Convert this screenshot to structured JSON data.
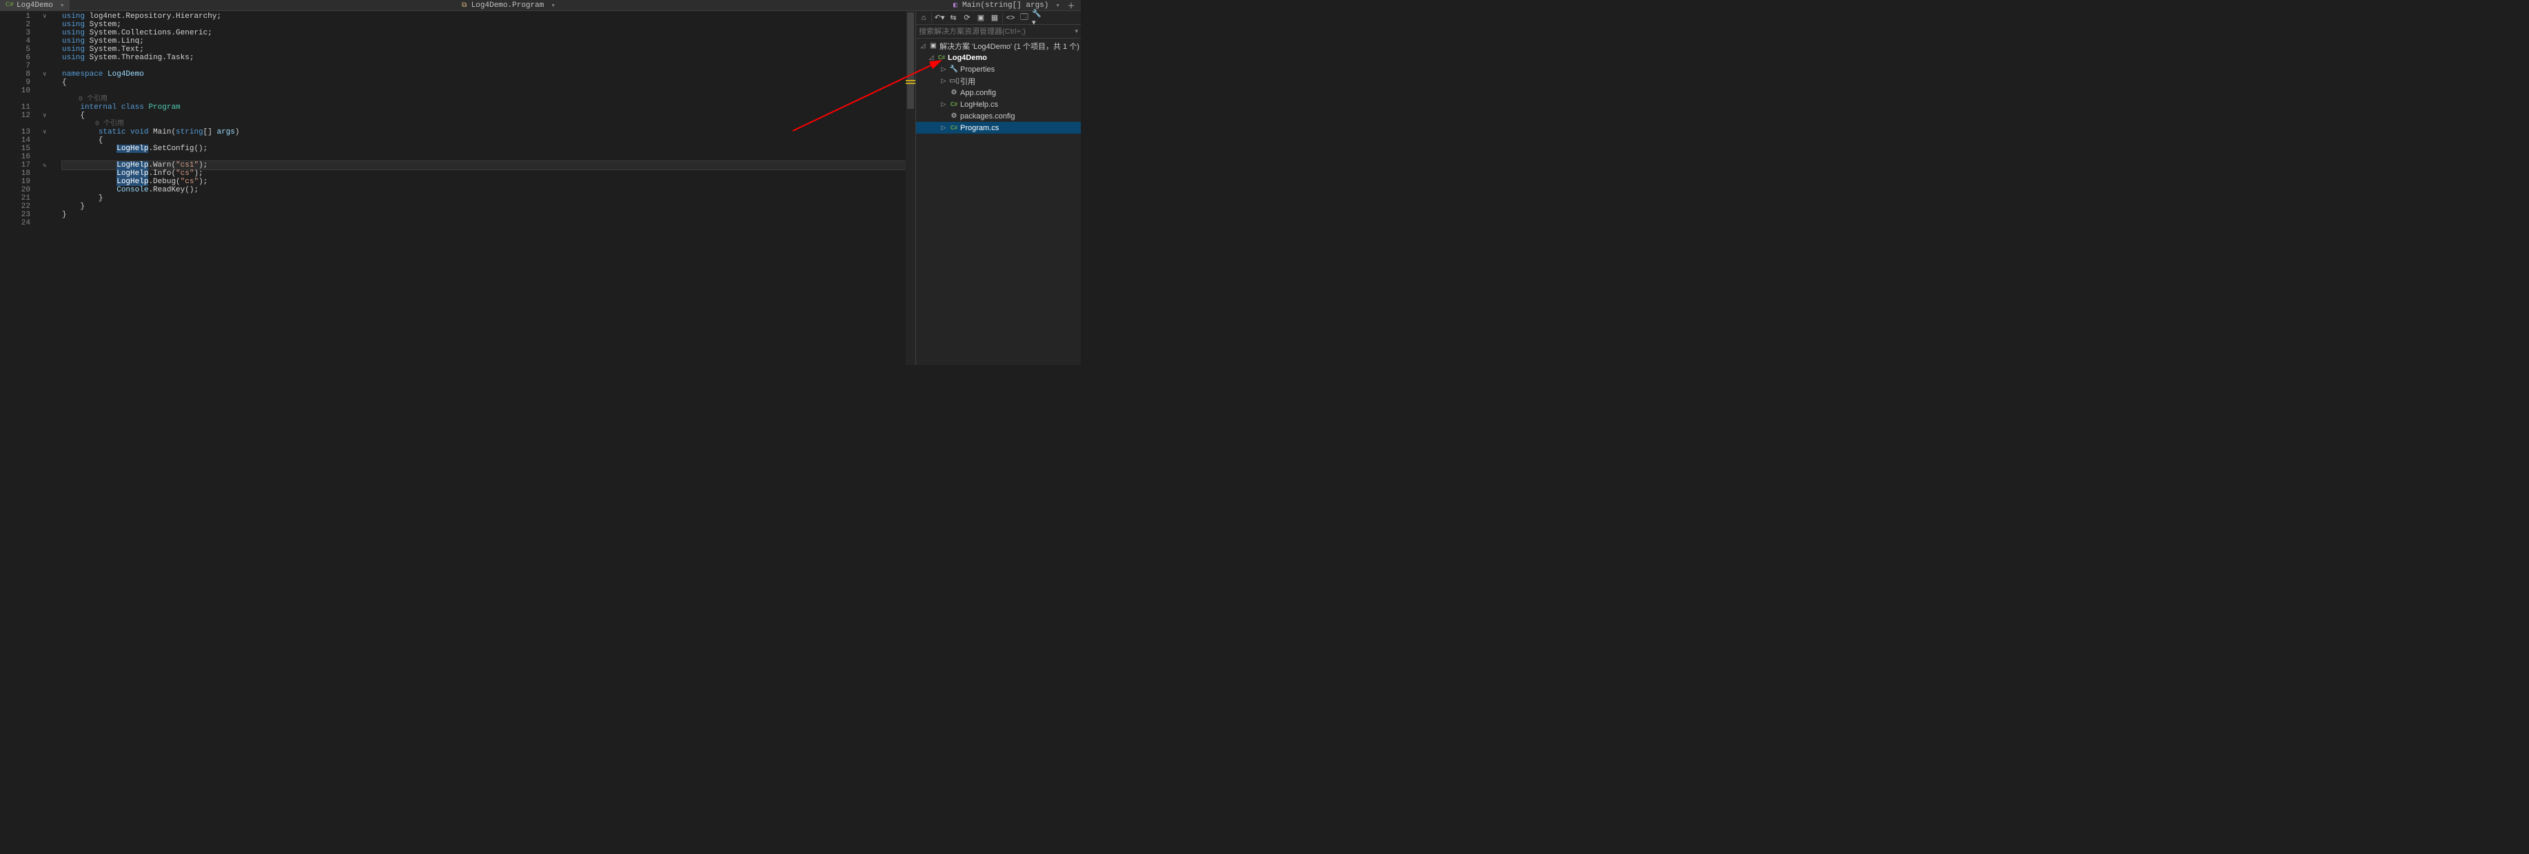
{
  "breadcrumb": {
    "path1_icon": "csharp-file-icon",
    "path1": "Log4Demo",
    "path2_icon": "namespace-icon",
    "path2": "Log4Demo.Program",
    "path3_icon": "method-icon",
    "path3": "Main(string[] args)"
  },
  "code": {
    "lines": [
      {
        "n": 1,
        "fold": "∨",
        "html": "<span class='kw'>using</span> log4net.Repository.Hierarchy;"
      },
      {
        "n": 2,
        "html": "<span class='kw'>using</span> System;"
      },
      {
        "n": 3,
        "html": "<span class='kw'>using</span> System.Collections.Generic;"
      },
      {
        "n": 4,
        "html": "<span class='kw'>using</span> System.Linq;"
      },
      {
        "n": 5,
        "html": "<span class='kw'>using</span> System.Text;"
      },
      {
        "n": 6,
        "html": "<span class='kw'>using</span> System.Threading.Tasks;"
      },
      {
        "n": 7,
        "html": ""
      },
      {
        "n": 8,
        "fold": "∨",
        "html": "<span class='kw'>namespace</span> <span class='typ'>Log4Demo</span>"
      },
      {
        "n": 9,
        "html": "{"
      },
      {
        "n": 10,
        "html": ""
      },
      {
        "n": "",
        "hint": "    0 个引用",
        "isHint": true
      },
      {
        "n": 11,
        "html": "    <span class='kw'>internal</span> <span class='kw'>class</span> <span class='cls'>Program</span>"
      },
      {
        "n": 12,
        "fold": "∨",
        "html": "    {"
      },
      {
        "n": "",
        "hint": "        0 个引用",
        "isHint": true
      },
      {
        "n": 13,
        "fold": "∨",
        "html": "        <span class='kw'>static</span> <span class='kw'>void</span> Main(<span class='kw'>string</span>[] <span class='param'>args</span>)"
      },
      {
        "n": 14,
        "html": "        {"
      },
      {
        "n": 15,
        "html": "            <span class='sel'>LogHelp</span>.SetConfig();"
      },
      {
        "n": 16,
        "html": ""
      },
      {
        "n": 17,
        "current": true,
        "pencil": true,
        "html": "            <span class='sel'>LogHelp</span>.Warn(<span class='str'>\"cs1\"</span>);"
      },
      {
        "n": 18,
        "html": "            <span class='sel'>LogHelp</span>.Info(<span class='str'>\"cs\"</span>);"
      },
      {
        "n": 19,
        "html": "            <span class='sel'>LogHelp</span>.Debug(<span class='str'>\"cs\"</span>);"
      },
      {
        "n": 20,
        "html": "            <span class='typ'>Console</span>.ReadKey();"
      },
      {
        "n": 21,
        "html": "        }"
      },
      {
        "n": 22,
        "html": "    }"
      },
      {
        "n": 23,
        "html": "}"
      },
      {
        "n": 24,
        "html": ""
      }
    ]
  },
  "search_placeholder": "搜索解决方案资源管理器(Ctrl+;)",
  "solution": {
    "root": "解决方案 'Log4Demo' (1 个项目，共 1 个)",
    "project": "Log4Demo",
    "items": [
      {
        "icon": "wrench-icon",
        "label": "Properties",
        "arrow": "▷"
      },
      {
        "icon": "ref-icon",
        "label": "引用",
        "arrow": "▷"
      },
      {
        "icon": "config-icon",
        "label": "App.config",
        "arrow": ""
      },
      {
        "icon": "cs-icon",
        "label": "LogHelp.cs",
        "arrow": "▷"
      },
      {
        "icon": "config-icon",
        "label": "packages.config",
        "arrow": ""
      },
      {
        "icon": "cs-icon",
        "label": "Program.cs",
        "arrow": "▷",
        "selected": true
      }
    ]
  }
}
